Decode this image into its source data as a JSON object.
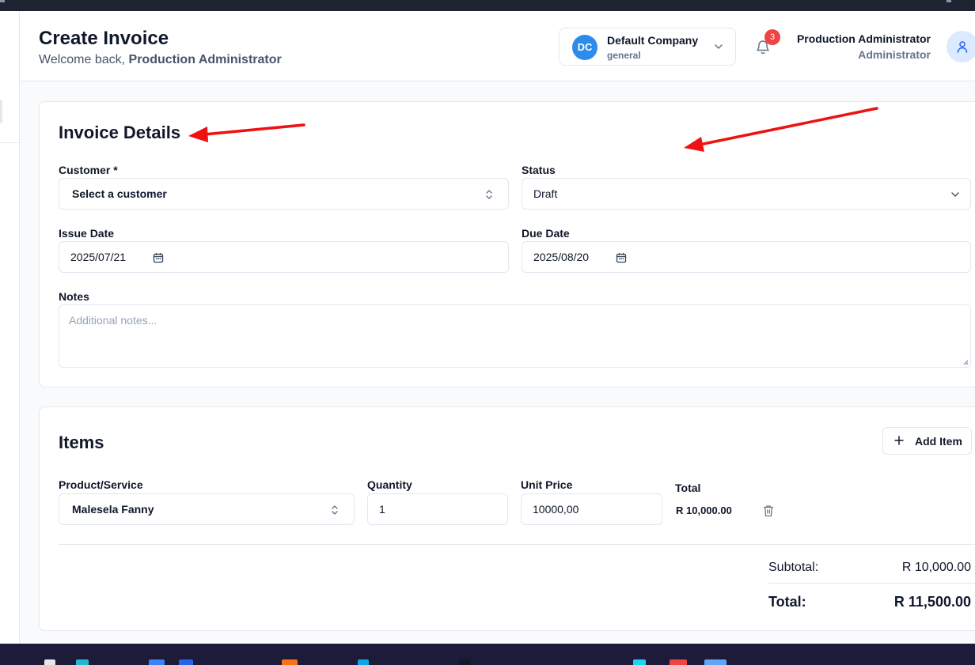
{
  "header": {
    "title": "Create Invoice",
    "welcome_prefix": "Welcome back, ",
    "welcome_user": "Production Administrator"
  },
  "company": {
    "initials": "DC",
    "name": "Default Company",
    "subtitle": "general",
    "icon": "chevron-down-icon"
  },
  "notifications": {
    "count": "3",
    "icon": "bell-icon"
  },
  "user": {
    "name": "Production Administrator",
    "role": "Administrator",
    "icon": "user-icon"
  },
  "details": {
    "title": "Invoice Details",
    "customer_label": "Customer *",
    "customer_value": "Select a customer",
    "status_label": "Status",
    "status_value": "Draft",
    "issue_date_label": "Issue Date",
    "issue_date_value": "2025/07/21",
    "due_date_label": "Due Date",
    "due_date_value": "2025/08/20",
    "notes_label": "Notes",
    "notes_placeholder": "Additional notes..."
  },
  "items": {
    "title": "Items",
    "add_label": "Add Item",
    "col_product": "Product/Service",
    "col_quantity": "Quantity",
    "col_unit_price": "Unit Price",
    "col_total": "Total",
    "rows": [
      {
        "product": "Malesela Fanny",
        "quantity": "1",
        "unit_price": "10000,00",
        "total": "R 10,000.00"
      }
    ]
  },
  "summary": {
    "subtotal_label": "Subtotal:",
    "subtotal_value": "R 10,000.00",
    "total_label": "Total:",
    "total_value": "R 11,500.00"
  },
  "colors": {
    "accent": "#2d8ceb",
    "badge": "#ef4444",
    "annotation_arrow": "#ee1111"
  }
}
